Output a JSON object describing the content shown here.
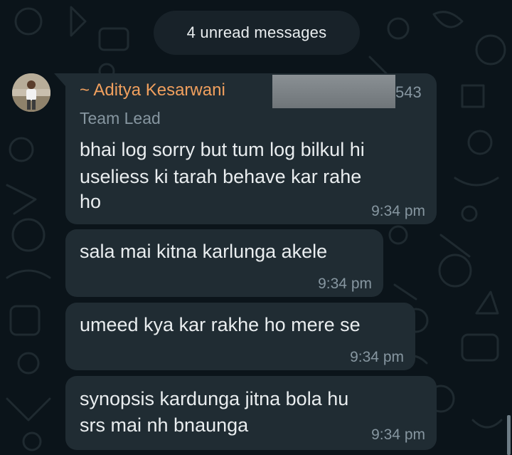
{
  "unread_banner": "4 unread messages",
  "sender": {
    "name": "~ Aditya Kesarwani",
    "role": "Team Lead",
    "phone_fragment": "543"
  },
  "messages": [
    {
      "lines": [
        "bhai log sorry but tum log bilkul hi",
        "useliess ki tarah behave kar rahe",
        "ho"
      ],
      "time": "9:34 pm"
    },
    {
      "lines": [
        "sala mai kitna karlunga akele"
      ],
      "time": "9:34 pm"
    },
    {
      "lines": [
        "umeed kya kar rakhe ho mere se"
      ],
      "time": "9:34 pm"
    },
    {
      "lines": [
        "synopsis kardunga jitna bola hu",
        "srs mai nh bnaunga"
      ],
      "time": "9:34 pm"
    }
  ],
  "colors": {
    "background": "#0b141a",
    "bubble": "#202c33",
    "sender_name": "#f1a05e",
    "secondary_text": "#8696a0",
    "primary_text": "#e9edef"
  },
  "icons": [
    "doodle-wallpaper",
    "avatar-photo"
  ]
}
